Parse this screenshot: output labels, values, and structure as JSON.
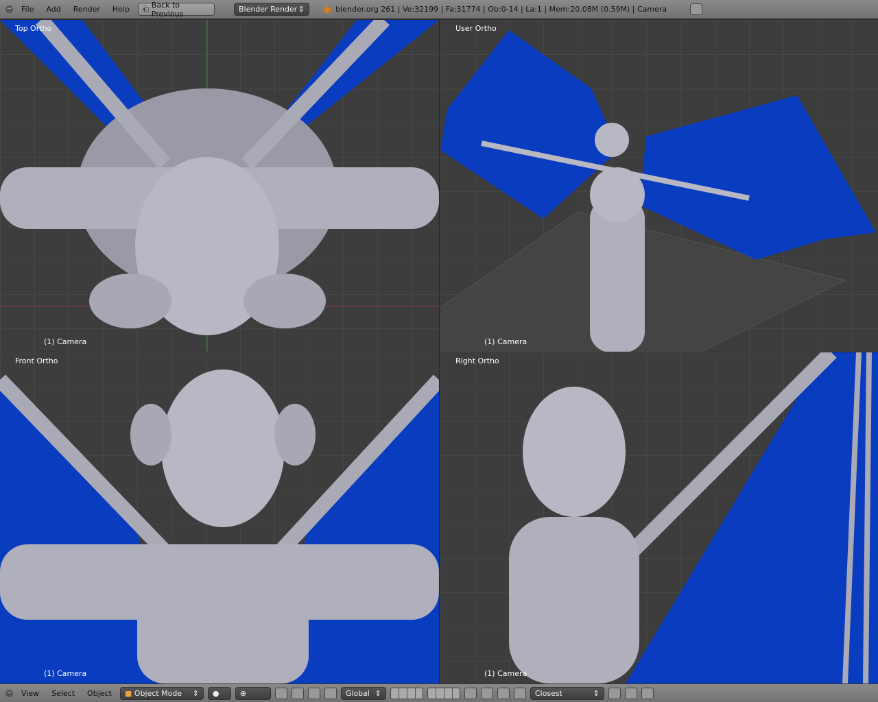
{
  "header": {
    "menus": [
      "File",
      "Add",
      "Render",
      "Help"
    ],
    "back_button": "Back to Previous",
    "render_engine": "Blender Render",
    "stats": "blender.org 261 | Ve:32199 | Fa:31774 | Ob:0-14 | La:1 | Mem:20.08M (0.59M) | Camera"
  },
  "viewports": [
    {
      "label": "Top Ortho",
      "camera": "(1) Camera"
    },
    {
      "label": "User Ortho",
      "camera": "(1) Camera"
    },
    {
      "label": "Front Ortho",
      "camera": "(1) Camera"
    },
    {
      "label": "Right Ortho",
      "camera": "(1) Camera"
    }
  ],
  "footer": {
    "menus": [
      "View",
      "Select",
      "Object"
    ],
    "mode": "Object Mode",
    "orientation": "Global",
    "snap": "Closest"
  },
  "colors": {
    "wing": "#0a3cc0",
    "body": "#b8b8c4",
    "viewport": "#3d3d3d"
  }
}
